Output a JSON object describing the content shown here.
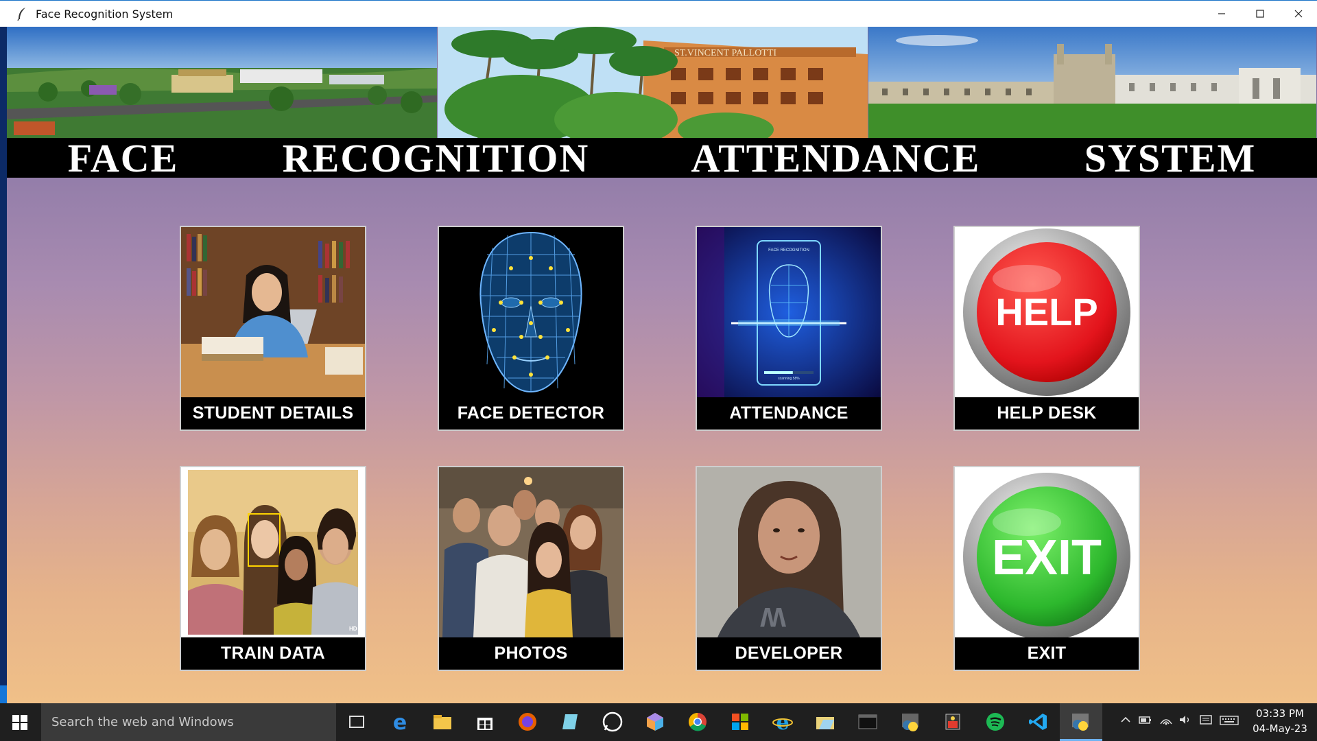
{
  "window": {
    "title": "Face Recognition System"
  },
  "header": {
    "title": "FACE   RECOGNITION   ATTENDANCE   SYSTEM",
    "banner_sign": "ST.VINCENT PALLOTTI"
  },
  "tiles": [
    {
      "label": "STUDENT DETAILS"
    },
    {
      "label": "FACE DETECTOR"
    },
    {
      "label": "ATTENDANCE",
      "screen_text": "FACE RECOGNITION",
      "scan_text": "scanning 58%",
      "scan_progress": 0.58
    },
    {
      "label": "HELP DESK",
      "button_text": "HELP"
    },
    {
      "label": "TRAIN DATA",
      "badge": "HD"
    },
    {
      "label": "PHOTOS"
    },
    {
      "label": "DEVELOPER"
    },
    {
      "label": "EXIT",
      "button_text": "EXIT"
    }
  ],
  "taskbar": {
    "search_placeholder": "Search the web and Windows",
    "apps": [
      "task-view",
      "edge",
      "file-explorer",
      "store",
      "firefox",
      "notes",
      "whatsapp",
      "3d-viewer",
      "chrome",
      "office",
      "internet-explorer",
      "folder",
      "terminal",
      "python-idle",
      "media-app",
      "spotify",
      "vscode",
      "python-app"
    ],
    "clock_time": "03:33 PM",
    "clock_date": "04-May-23"
  },
  "colors": {
    "accent": "#1476d9",
    "help_red": "#e3141c",
    "exit_green": "#2db82d"
  }
}
